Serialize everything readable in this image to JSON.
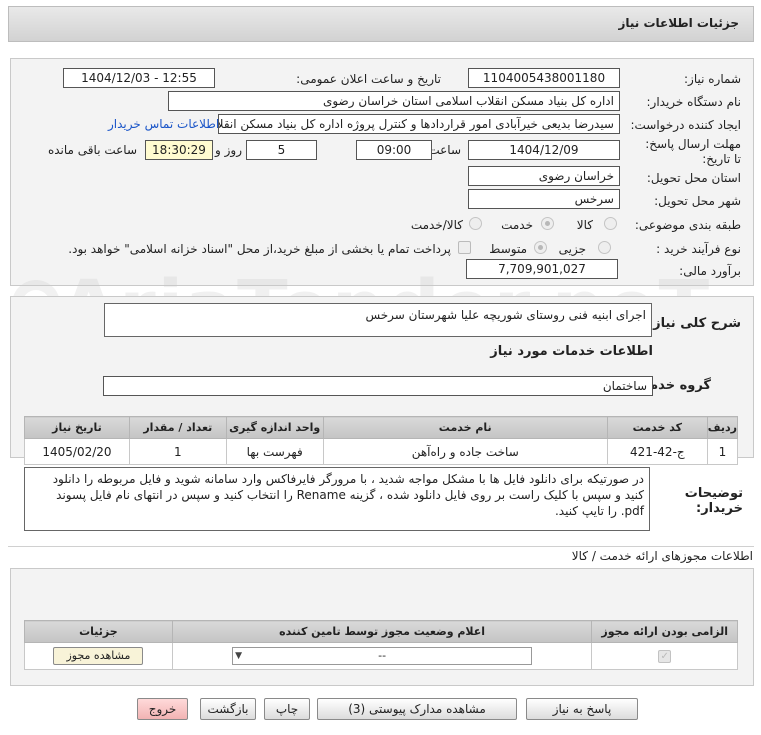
{
  "header": {
    "title": "جزئیات اطلاعات نیاز"
  },
  "fields": {
    "need_number_label": "شماره نیاز:",
    "need_number": "1104005438001180",
    "announce_label": "تاریخ و ساعت اعلان عمومی:",
    "announce_value": "1404/12/03 - 12:55",
    "buyer_org_label": "نام دستگاه خریدار:",
    "buyer_org": "اداره کل بنیاد مسکن انقلاب اسلامی استان خراسان رضوی",
    "creator_label": "ایجاد کننده درخواست:",
    "creator": "سیدرضا بدیعی خیرآبادی امور قراردادها و کنترل پروژه اداره کل بنیاد مسکن انقلاب اسلامی",
    "contact_link": "اطلاعات تماس خریدار",
    "deadline_label": "مهلت ارسال پاسخ: تا تاریخ:",
    "deadline_date": "1404/12/09",
    "time_label": "ساعت",
    "deadline_time": "09:00",
    "days_value": "5",
    "days_label": "روز و",
    "remaining_time": "18:30:29",
    "remaining_label": "ساعت باقی مانده",
    "province_label": "استان محل تحویل:",
    "province": "خراسان رضوی",
    "city_label": "شهر محل تحویل:",
    "city": "سرخس",
    "category_label": "طبقه بندی موضوعی:",
    "category_options": [
      "کالا",
      "خدمت",
      "کالا/خدمت"
    ],
    "category_selected": "خدمت",
    "process_label": "نوع فرآیند خرید :",
    "process_options": [
      "جزیی",
      "متوسط"
    ],
    "process_selected": "متوسط",
    "payment_note": "پرداخت تمام یا بخشی از مبلغ خرید،از محل \"اسناد خزانه اسلامی\" خواهد بود.",
    "estimate_label": "برآورد مالی:",
    "estimate": "7,709,901,027"
  },
  "general": {
    "label": "شرح کلی نیاز:",
    "text": "اجرای ابنیه فنی روستای شوریچه علیا شهرستان سرخس"
  },
  "services": {
    "section_title": "اطلاعات خدمات مورد نیاز",
    "group_label": "گروه خدمت:",
    "group_value": "ساختمان",
    "columns": [
      "ردیف",
      "کد خدمت",
      "نام خدمت",
      "واحد اندازه گیری",
      "تعداد / مقدار",
      "تاریخ نیاز"
    ],
    "rows": [
      {
        "index": "1",
        "code": "ج-42-421",
        "name": "ساخت جاده و راه‌آهن",
        "unit": "فهرست بها",
        "qty": "1",
        "date": "1405/02/20"
      }
    ]
  },
  "buyer_notes": {
    "label": "توضیحات خریدار:",
    "text": "در صورتیکه برای دانلود فایل ها با مشکل مواجه شدید ، با مرورگر فایرفاکس وارد سامانه شوید و فایل مربوطه را دانلود کنید و سپس با کلیک راست بر روی فایل دانلود شده ، گزینه Rename را انتخاب کنید و سپس در انتهای نام فایل پسوند pdf. را تایپ کنید."
  },
  "permits": {
    "section_title": "اطلاعات مجوزهای ارائه خدمت / کالا",
    "columns": [
      "الزامی بودن ارائه مجوز",
      "اعلام وضعیت مجوز توسط تامین کننده",
      "جزئیات"
    ],
    "select_value": "--",
    "view_button": "مشاهده مجوز"
  },
  "buttons": {
    "reply": "پاسخ به نیاز",
    "attachments": "مشاهده مدارک پیوستی (3)",
    "print": "چاپ",
    "back": "بازگشت",
    "exit": "خروج"
  },
  "watermark": {
    "text": "AriaTender.neT"
  },
  "colors": {
    "link": "#1a55c8",
    "highlight": "#fffbd0",
    "exit_button": "#f2b3b3"
  }
}
